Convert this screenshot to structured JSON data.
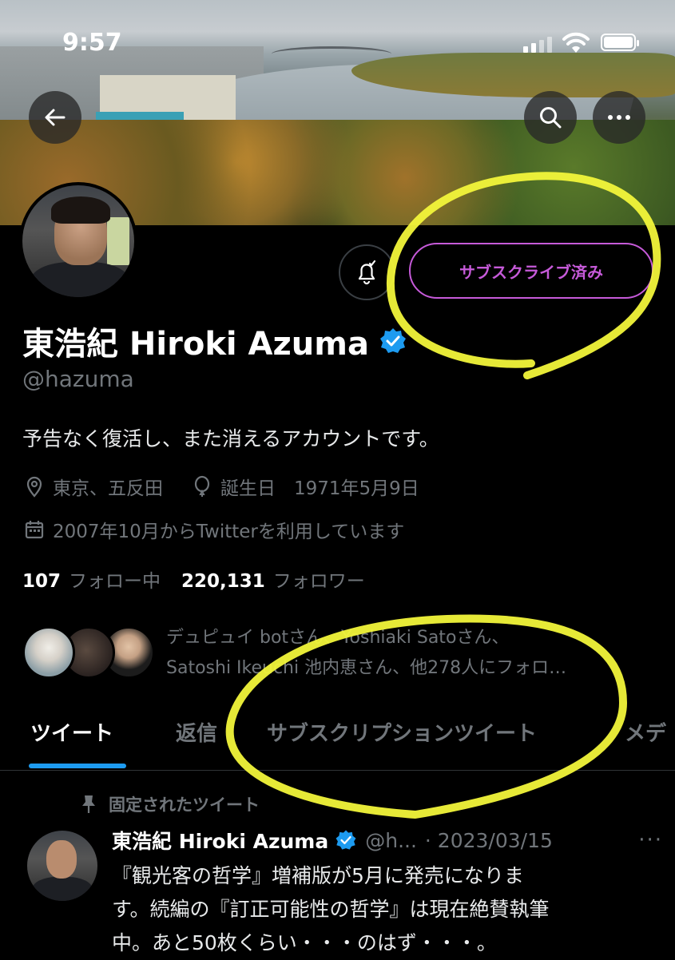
{
  "status_bar": {
    "time": "9:57"
  },
  "colors": {
    "accent": "#1d9bf0",
    "subscribed": "#c65ad9",
    "highlight": "#f2f53a"
  },
  "header": {
    "back_icon": "arrow-left-icon",
    "search_icon": "search-icon",
    "more_icon": "more-horizontal-icon"
  },
  "profile": {
    "display_name": "東浩紀 Hiroki Azuma",
    "handle": "@hazuma",
    "bio": "予告なく復活し、また消えるアカウントです。",
    "location": "東京、五反田",
    "birthday": "誕生日　1971年5月9日",
    "joined": "2007年10月からTwitterを利用しています",
    "following_count": "107",
    "following_label": "フォロー中",
    "followers_count": "220,131",
    "followers_label": "フォロワー",
    "subscribe_label": "サブスクライブ済み",
    "known_followers_line1": "デュピュイ botさん、Yoshiaki Satoさん、",
    "known_followers_line2": "Satoshi Ikeuchi 池内恵さん、他278人にフォロ…"
  },
  "tabs": [
    {
      "label": "ツイート",
      "active": true
    },
    {
      "label": "返信",
      "active": false
    },
    {
      "label": "サブスクリプションツイート",
      "active": false
    },
    {
      "label": "メデ",
      "active": false
    }
  ],
  "pinned_tweet": {
    "pinned_label": "固定されたツイート",
    "author": "東浩紀 Hiroki Azuma",
    "handle": "@h...",
    "date": "· 2023/03/15",
    "more": "···",
    "text_line1": "『観光客の哲学』増補版が5月に発売になりま",
    "text_line2": "す。続編の『訂正可能性の哲学』は現在絶賛執筆",
    "text_line3": "中。あと50枚くらい・・・のはず・・・。"
  }
}
